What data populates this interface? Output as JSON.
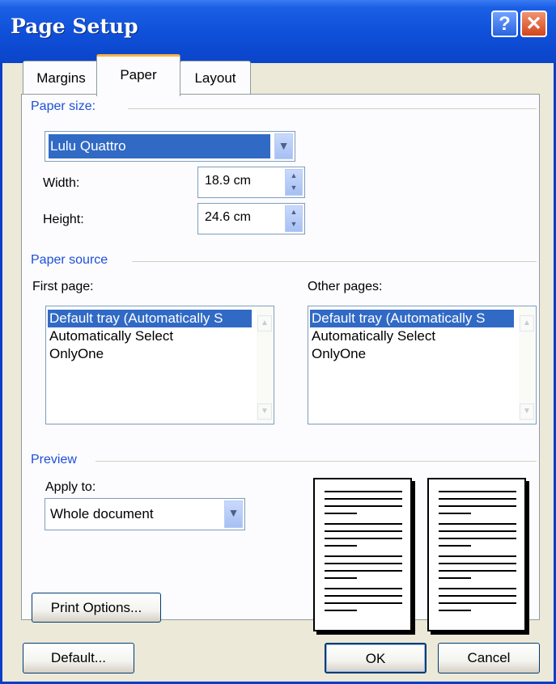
{
  "window": {
    "title": "Page Setup",
    "help_label": "?",
    "close_label": "✕"
  },
  "tabs": [
    {
      "label": "Margins",
      "active": false
    },
    {
      "label": "Paper",
      "active": true
    },
    {
      "label": "Layout",
      "active": false
    }
  ],
  "paper_size": {
    "group_label": "Paper size:",
    "selected": "Lulu Quattro",
    "width_label": "Width:",
    "width_value": "18.9 cm",
    "height_label": "Height:",
    "height_value": "24.6 cm"
  },
  "paper_source": {
    "group_label": "Paper source",
    "first_page_label": "First page:",
    "other_pages_label": "Other pages:",
    "first_page_items": [
      "Default tray (Automatically S",
      "Automatically Select",
      "OnlyOne"
    ],
    "other_pages_items": [
      "Default tray (Automatically S",
      "Automatically Select",
      "OnlyOne"
    ],
    "selected_index": 0
  },
  "preview": {
    "group_label": "Preview",
    "apply_to_label": "Apply to:",
    "apply_to_value": "Whole document"
  },
  "buttons": {
    "print_options": "Print Options...",
    "default": "Default...",
    "ok": "OK",
    "cancel": "Cancel"
  },
  "colors": {
    "title_bar": "#0a44c9",
    "accent": "#1e4fd6",
    "selection": "#316ac5",
    "tab_highlight": "#f7b34a"
  }
}
